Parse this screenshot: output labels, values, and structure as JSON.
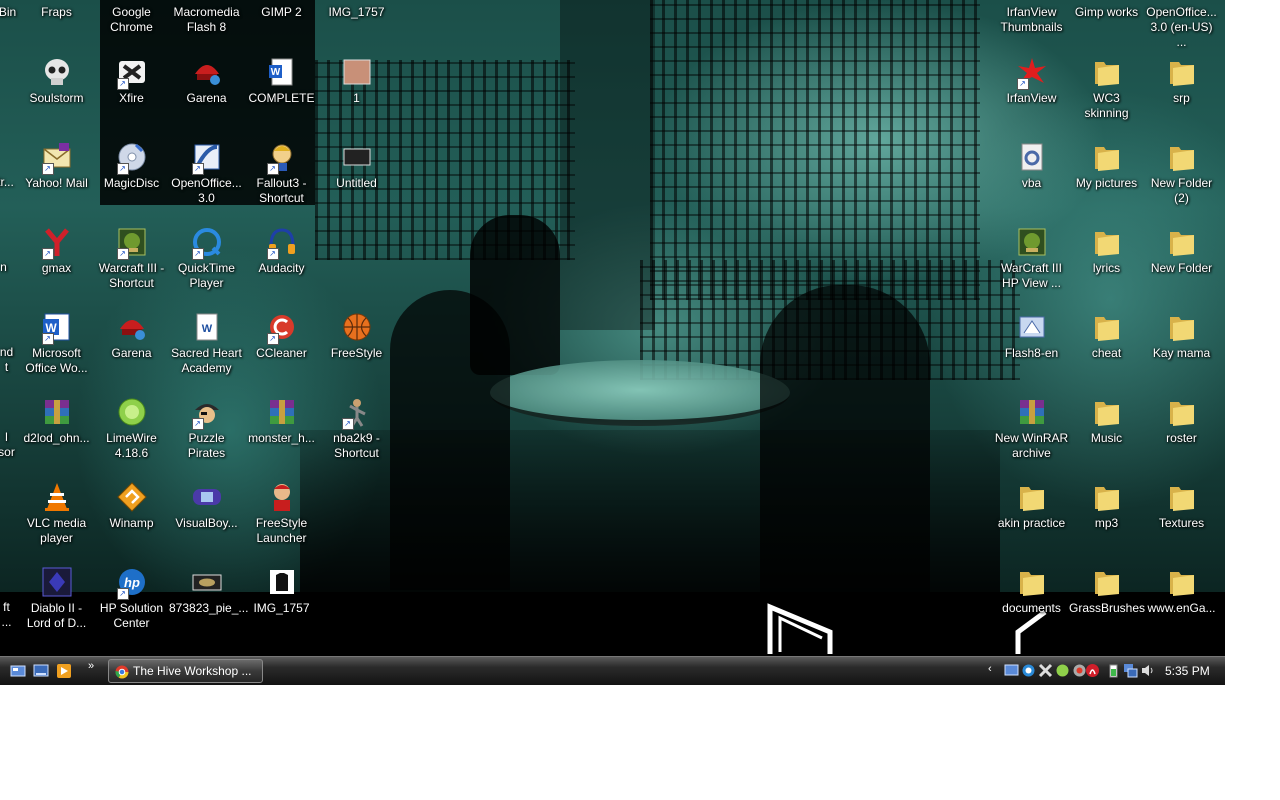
{
  "desktop": {
    "icons": {
      "c0_0": {
        "label": "Bin",
        "icon": "recycle-bin-icon"
      },
      "c0_1": {
        "label": "tr...",
        "icon": "unknown-icon"
      },
      "c0_2": {
        "label": "n",
        "icon": "unknown-icon"
      },
      "c0_3": {
        "label": "nd\nt",
        "icon": "unknown-icon"
      },
      "c0_4": {
        "label": "l\nsor",
        "icon": "unknown-icon"
      },
      "c0_5": {
        "label": "ft\n...",
        "icon": "unknown-icon"
      },
      "fraps": {
        "label": "Fraps",
        "icon": "fraps-icon"
      },
      "soulstorm": {
        "label": "Soulstorm",
        "icon": "skull-icon"
      },
      "yahoo": {
        "label": "Yahoo! Mail",
        "icon": "yahoo-mail-icon"
      },
      "gmax": {
        "label": "gmax",
        "icon": "gmax-icon"
      },
      "msoffice": {
        "label": "Microsoft\nOffice Wo...",
        "icon": "word-icon"
      },
      "d2lod": {
        "label": "d2lod_ohn...",
        "icon": "winrar-icon"
      },
      "vlc": {
        "label": "VLC media\nplayer",
        "icon": "vlc-cone-icon"
      },
      "diablo": {
        "label": "Diablo II -\nLord of D...",
        "icon": "diablo-icon"
      },
      "chrome": {
        "label": "Google\nChrome",
        "icon": "chrome-icon"
      },
      "xfire": {
        "label": "Xfire",
        "icon": "xfire-icon"
      },
      "magicdisc": {
        "label": "MagicDisc",
        "icon": "disc-icon"
      },
      "wc3short": {
        "label": "Warcraft III -\nShortcut",
        "icon": "warcraft-icon"
      },
      "garena1": {
        "label": "Garena",
        "icon": "garena-icon"
      },
      "limewire": {
        "label": "LimeWire\n4.18.6",
        "icon": "limewire-icon"
      },
      "winamp": {
        "label": "Winamp",
        "icon": "winamp-icon"
      },
      "hp": {
        "label": "HP Solution\nCenter",
        "icon": "hp-icon"
      },
      "flash8": {
        "label": "Macromedia\nFlash 8",
        "icon": "flash-icon"
      },
      "garena2": {
        "label": "Garena",
        "icon": "garena-icon"
      },
      "oo30": {
        "label": "OpenOffice...\n3.0",
        "icon": "openoffice-icon"
      },
      "quicktime": {
        "label": "QuickTime\nPlayer",
        "icon": "quicktime-icon"
      },
      "sacred": {
        "label": "Sacred Heart\nAcademy",
        "icon": "document-icon"
      },
      "puzzle": {
        "label": "Puzzle Pirates",
        "icon": "pirate-icon"
      },
      "visualboy": {
        "label": "VisualBoy...",
        "icon": "gameboy-icon"
      },
      "pie": {
        "label": "873823_pie_...",
        "icon": "image-thumbnail-icon"
      },
      "gimp": {
        "label": "GIMP 2",
        "icon": "gimp-icon"
      },
      "complete": {
        "label": "COMPLETE",
        "icon": "word-document-icon"
      },
      "fallout": {
        "label": "Fallout3 -\nShortcut",
        "icon": "vault-boy-icon"
      },
      "audacity": {
        "label": "Audacity",
        "icon": "headphones-icon"
      },
      "ccleaner": {
        "label": "CCleaner",
        "icon": "ccleaner-icon"
      },
      "monster": {
        "label": "monster_h...",
        "icon": "winrar-icon"
      },
      "fsLauncher": {
        "label": "FreeStyle\nLauncher",
        "icon": "player-icon"
      },
      "img1757b": {
        "label": "IMG_1757",
        "icon": "shirt-image-icon"
      },
      "img1757a": {
        "label": "IMG_1757",
        "icon": "image-icon"
      },
      "one": {
        "label": "1",
        "icon": "image-swatch-icon"
      },
      "untitled": {
        "label": "Untitled",
        "icon": "image-thumbnail-icon"
      },
      "freestyle": {
        "label": "FreeStyle",
        "icon": "basketball-icon"
      },
      "nba": {
        "label": "nba2k9 -\nShortcut",
        "icon": "player-icon"
      },
      "irfanthumb": {
        "label": "IrfanView\nThumbnails",
        "icon": "irfanview-icon"
      },
      "irfan": {
        "label": "IrfanView",
        "icon": "irfanview-icon"
      },
      "vba": {
        "label": "vba",
        "icon": "settings-file-icon"
      },
      "wc3hp": {
        "label": "WarCraft III\nHP View ...",
        "icon": "warcraft-icon"
      },
      "flash8en": {
        "label": "Flash8-en",
        "icon": "installer-icon"
      },
      "winrarnew": {
        "label": "New WinRAR\narchive",
        "icon": "winrar-icon"
      },
      "akin": {
        "label": "akin practice",
        "icon": "folder-icon"
      },
      "documents": {
        "label": "documents",
        "icon": "folder-icon"
      },
      "gimpworks": {
        "label": "Gimp works",
        "icon": "folder-icon"
      },
      "wc3skin": {
        "label": "WC3\nskinning",
        "icon": "folder-icon"
      },
      "mypics": {
        "label": "My pictures",
        "icon": "folder-icon"
      },
      "lyrics": {
        "label": "lyrics",
        "icon": "folder-icon"
      },
      "cheat": {
        "label": "cheat",
        "icon": "folder-icon"
      },
      "music": {
        "label": "Music",
        "icon": "folder-icon"
      },
      "mp3": {
        "label": "mp3",
        "icon": "folder-icon"
      },
      "grass": {
        "label": "GrassBrushes",
        "icon": "folder-icon"
      },
      "oous": {
        "label": "OpenOffice...\n3.0 (en-US) ...",
        "icon": "openoffice-icon"
      },
      "srp": {
        "label": "srp",
        "icon": "folder-icon"
      },
      "newfolder2": {
        "label": "New Folder\n(2)",
        "icon": "folder-icon"
      },
      "newfolder": {
        "label": "New Folder",
        "icon": "folder-icon"
      },
      "kay": {
        "label": "Kay mama",
        "icon": "folder-icon"
      },
      "roster": {
        "label": "roster",
        "icon": "folder-icon"
      },
      "textures": {
        "label": "Textures",
        "icon": "folder-icon"
      },
      "enga": {
        "label": "www.enGa...",
        "icon": "folder-icon"
      }
    }
  },
  "taskbar": {
    "quick_launch": [
      "show-desktop-icon",
      "switch-windows-icon",
      "media-player-icon"
    ],
    "quick_launch_more": "»",
    "active_window": "The Hive Workshop ...",
    "tray_expand": "‹",
    "tray_icons": [
      "network-icon",
      "security-icon",
      "chat-icon",
      "update-icon",
      "antivirus-icon",
      "adobe-icon",
      "battery-icon",
      "network-connection-icon",
      "volume-icon"
    ],
    "clock": "5:35 PM"
  },
  "colors": {
    "folder": "#e8c65a",
    "taskbar": "#2b2b2b",
    "wallpaper_tint": "#2a6e66"
  }
}
